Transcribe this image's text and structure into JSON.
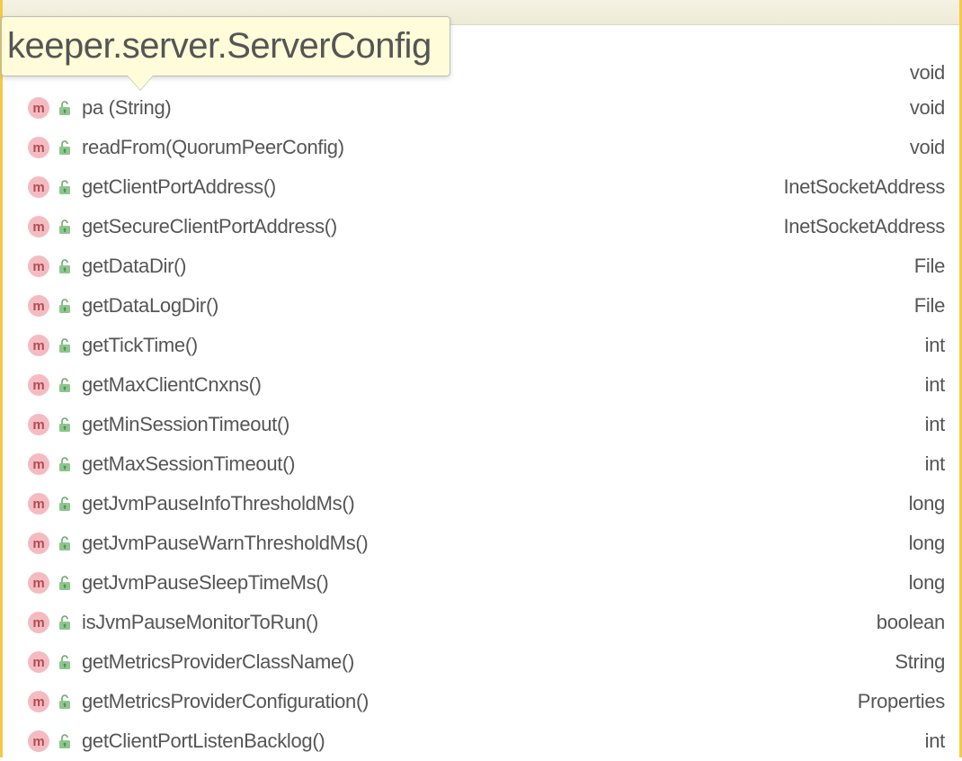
{
  "tooltip": {
    "text": "keeper.server.ServerConfig"
  },
  "icons": {
    "method_letter": "m"
  },
  "items": [
    {
      "name": "pa     (String)",
      "ret": "void"
    },
    {
      "name": "readFrom(QuorumPeerConfig)",
      "ret": "void"
    },
    {
      "name": "getClientPortAddress()",
      "ret": "InetSocketAddress"
    },
    {
      "name": "getSecureClientPortAddress()",
      "ret": "InetSocketAddress"
    },
    {
      "name": "getDataDir()",
      "ret": "File"
    },
    {
      "name": "getDataLogDir()",
      "ret": "File"
    },
    {
      "name": "getTickTime()",
      "ret": "int"
    },
    {
      "name": "getMaxClientCnxns()",
      "ret": "int"
    },
    {
      "name": "getMinSessionTimeout()",
      "ret": "int"
    },
    {
      "name": "getMaxSessionTimeout()",
      "ret": "int"
    },
    {
      "name": "getJvmPauseInfoThresholdMs()",
      "ret": "long"
    },
    {
      "name": "getJvmPauseWarnThresholdMs()",
      "ret": "long"
    },
    {
      "name": "getJvmPauseSleepTimeMs()",
      "ret": "long"
    },
    {
      "name": "isJvmPauseMonitorToRun()",
      "ret": "boolean"
    },
    {
      "name": "getMetricsProviderClassName()",
      "ret": "String"
    },
    {
      "name": "getMetricsProviderConfiguration()",
      "ret": "Properties"
    },
    {
      "name": "getClientPortListenBacklog()",
      "ret": "int"
    }
  ]
}
